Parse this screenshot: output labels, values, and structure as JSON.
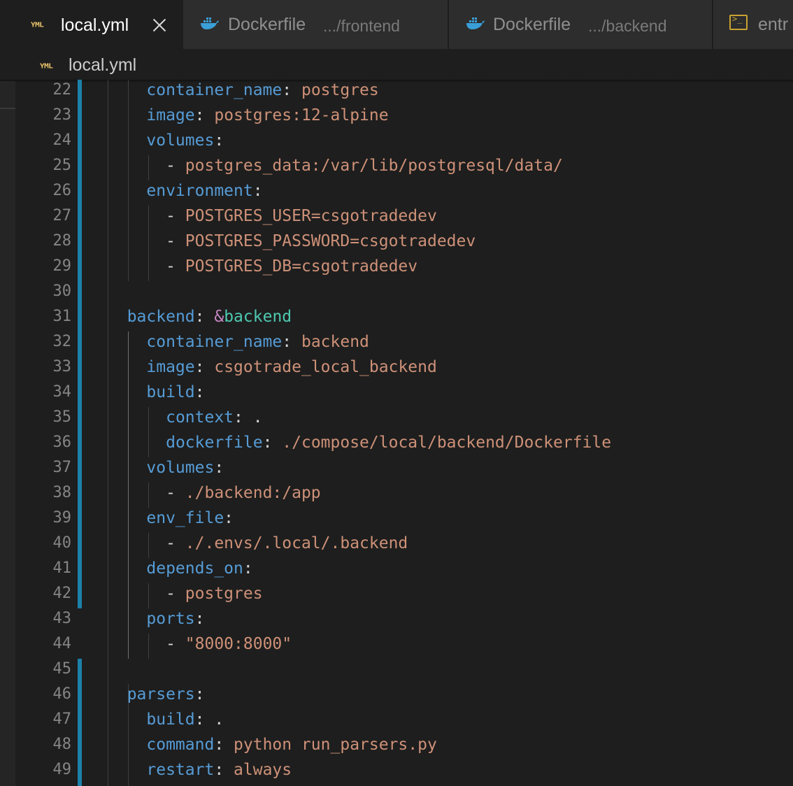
{
  "tabs": [
    {
      "label": "local.yml",
      "description": "",
      "icon": "yaml-icon",
      "active": true
    },
    {
      "label": "Dockerfile",
      "description": ".../frontend",
      "icon": "docker-icon",
      "active": false
    },
    {
      "label": "Dockerfile",
      "description": ".../backend",
      "icon": "docker-icon",
      "active": false
    },
    {
      "label": "entr",
      "description": "",
      "icon": "terminal-icon",
      "active": false
    }
  ],
  "icon_text": {
    "yaml": "YML"
  },
  "breadcrumb": {
    "file": "local.yml"
  },
  "colors": {
    "key": "#569cd6",
    "string": "#ce9178",
    "anchor_sigil": "#c586c0",
    "anchor_name": "#4ec9b0",
    "punctuation": "#d4d4d4",
    "line_number": "#858585",
    "git_modified_bar": "#1b81a8",
    "editor_background": "#1e1e1e"
  },
  "editor": {
    "lines": [
      {
        "n": "22",
        "indent": "    ",
        "key": "container_name",
        "value": "postgres"
      },
      {
        "n": "23",
        "indent": "    ",
        "key": "image",
        "value": "postgres:12-alpine"
      },
      {
        "n": "24",
        "indent": "    ",
        "key": "volumes",
        "value": ""
      },
      {
        "n": "25",
        "indent": "      ",
        "dash": "- ",
        "value": "postgres_data:/var/lib/postgresql/data/"
      },
      {
        "n": "26",
        "indent": "    ",
        "key": "environment",
        "value": ""
      },
      {
        "n": "27",
        "indent": "      ",
        "dash": "- ",
        "value": "POSTGRES_USER=csgotradedev"
      },
      {
        "n": "28",
        "indent": "      ",
        "dash": "- ",
        "value": "POSTGRES_PASSWORD=csgotradedev"
      },
      {
        "n": "29",
        "indent": "      ",
        "dash": "- ",
        "value": "POSTGRES_DB=csgotradedev"
      },
      {
        "n": "30",
        "indent": "",
        "value": ""
      },
      {
        "n": "31",
        "indent": "  ",
        "key": "backend",
        "anchor_sigil": "&",
        "anchor_name": "backend"
      },
      {
        "n": "32",
        "indent": "    ",
        "key": "container_name",
        "value": "backend"
      },
      {
        "n": "33",
        "indent": "    ",
        "key": "image",
        "value": "csgotrade_local_backend"
      },
      {
        "n": "34",
        "indent": "    ",
        "key": "build",
        "value": ""
      },
      {
        "n": "35",
        "indent": "      ",
        "key": "context",
        "value": ".",
        "value_plain": true
      },
      {
        "n": "36",
        "indent": "      ",
        "key": "dockerfile",
        "value": "./compose/local/backend/Dockerfile"
      },
      {
        "n": "37",
        "indent": "    ",
        "key": "volumes",
        "value": ""
      },
      {
        "n": "38",
        "indent": "      ",
        "dash": "- ",
        "value": "./backend:/app"
      },
      {
        "n": "39",
        "indent": "    ",
        "key": "env_file",
        "value": ""
      },
      {
        "n": "40",
        "indent": "      ",
        "dash": "- ",
        "value": "./.envs/.local/.backend"
      },
      {
        "n": "41",
        "indent": "    ",
        "key": "depends_on",
        "value": ""
      },
      {
        "n": "42",
        "indent": "      ",
        "dash": "- ",
        "value": "postgres"
      },
      {
        "n": "43",
        "indent": "    ",
        "key": "ports",
        "value": ""
      },
      {
        "n": "44",
        "indent": "      ",
        "dash": "- ",
        "value": "\"8000:8000\""
      },
      {
        "n": "45",
        "indent": "",
        "value": ""
      },
      {
        "n": "46",
        "indent": "  ",
        "key": "parsers",
        "value": ""
      },
      {
        "n": "47",
        "indent": "    ",
        "key": "build",
        "value": ".",
        "value_plain": true
      },
      {
        "n": "48",
        "indent": "    ",
        "key": "command",
        "value": "python run_parsers.py"
      },
      {
        "n": "49",
        "indent": "    ",
        "key": "restart",
        "value": "always"
      }
    ]
  }
}
